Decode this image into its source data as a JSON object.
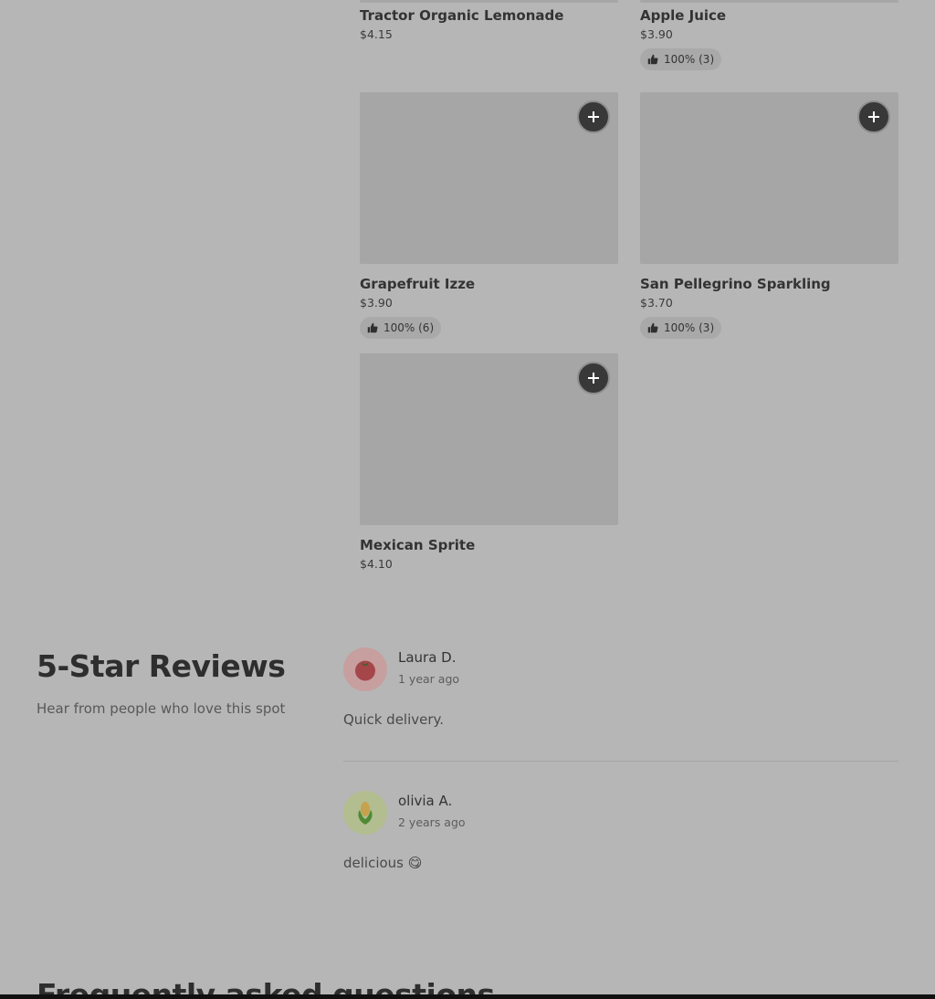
{
  "products": [
    {
      "name": "Tractor Organic Lemonade",
      "price": "$4.15",
      "rating": ""
    },
    {
      "name": "Apple Juice",
      "price": "$3.90",
      "rating": "100% (3)"
    },
    {
      "name": "Grapefruit Izze",
      "price": "$3.90",
      "rating": "100% (6)"
    },
    {
      "name": "San Pellegrino Sparkling",
      "price": "$3.70",
      "rating": "100% (3)"
    },
    {
      "name": "Mexican Sprite",
      "price": "$4.10",
      "rating": ""
    }
  ],
  "reviews_section": {
    "title": "5-Star Reviews",
    "subtitle": "Hear from people who love this spot",
    "reviews": [
      {
        "name": "Laura D.",
        "time": "1 year ago",
        "text": "Quick delivery.",
        "avatar_icon": "tomato-icon"
      },
      {
        "name": "olivia A.",
        "time": "2 years ago",
        "text": "delicious 😋",
        "avatar_icon": "corn-icon"
      }
    ]
  },
  "faq": {
    "title": "Frequently asked questions"
  },
  "colors": {
    "background": "#b6b6b6",
    "image_placeholder": "#a6a6a6",
    "add_button": "#383838",
    "rating_pill": "#a9a9a9"
  }
}
